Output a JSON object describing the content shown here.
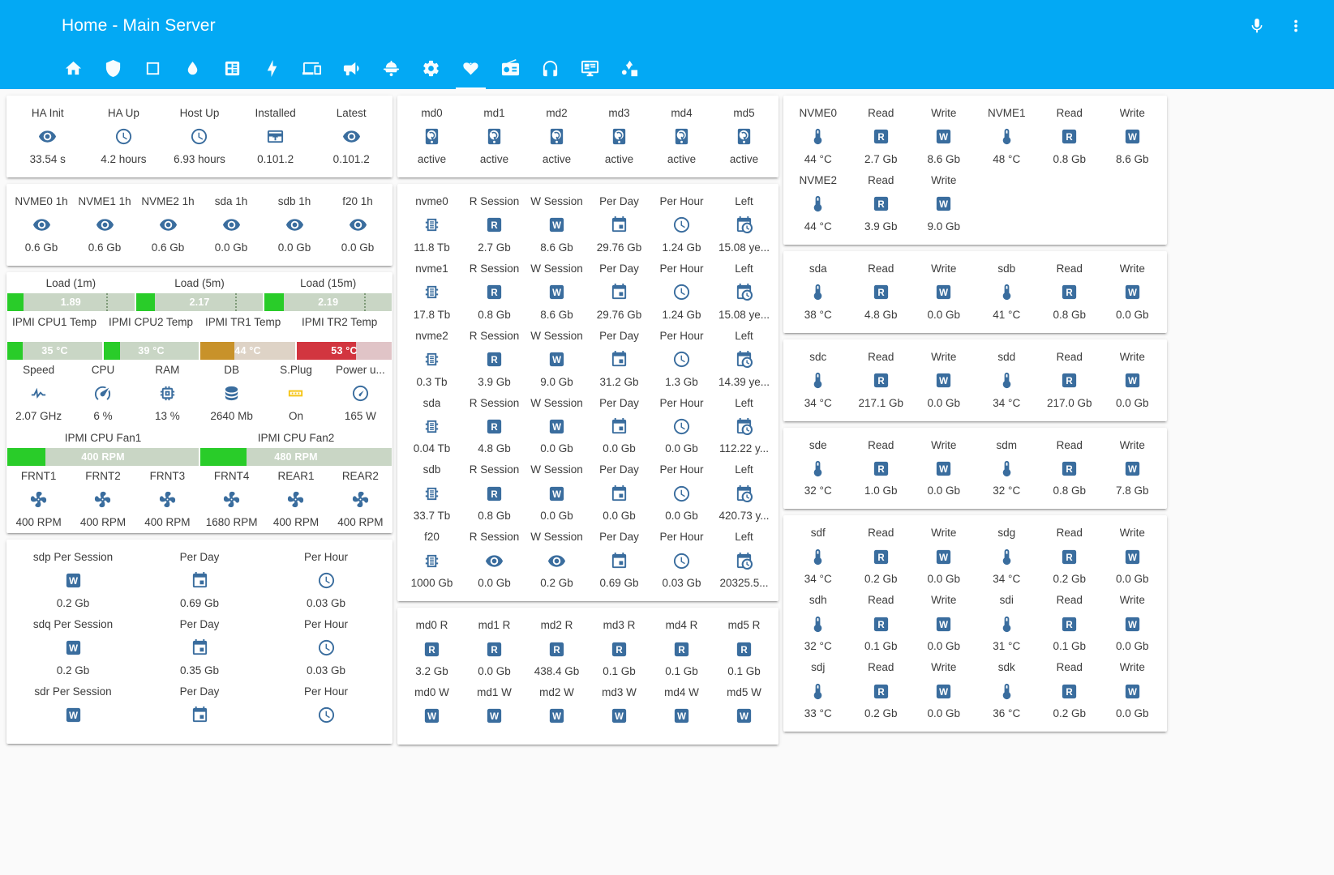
{
  "header": {
    "title": "Home - Main Server",
    "actions": [
      {
        "name": "assist-microphone-icon",
        "icon": "microphone"
      },
      {
        "name": "overflow-menu-icon",
        "icon": "dots-vertical"
      }
    ],
    "tabs": [
      {
        "name": "tab-home",
        "icon": "home",
        "active": false
      },
      {
        "name": "tab-shield",
        "icon": "shield",
        "active": false
      },
      {
        "name": "tab-square",
        "icon": "square",
        "active": false
      },
      {
        "name": "tab-water",
        "icon": "water",
        "active": false
      },
      {
        "name": "tab-calendar-grid",
        "icon": "book-grid",
        "active": false
      },
      {
        "name": "tab-lightning",
        "icon": "flash",
        "active": false
      },
      {
        "name": "tab-devices",
        "icon": "devices",
        "active": false
      },
      {
        "name": "tab-broadcast",
        "icon": "bullhorn",
        "active": false
      },
      {
        "name": "tab-lamp",
        "icon": "ceiling-light",
        "active": false
      },
      {
        "name": "tab-settings",
        "icon": "cog",
        "active": false
      },
      {
        "name": "tab-system-monitor",
        "icon": "heart-pulse",
        "active": true
      },
      {
        "name": "tab-radio",
        "icon": "radio",
        "active": false
      },
      {
        "name": "tab-headphones",
        "icon": "headphones",
        "active": false
      },
      {
        "name": "tab-monitor-dashboard",
        "icon": "monitor-dashboard",
        "active": false
      },
      {
        "name": "tab-shapes",
        "icon": "shapes",
        "active": false
      }
    ]
  },
  "cards": {
    "ha_status": {
      "columns": 5,
      "cells": [
        {
          "name": "HA Init",
          "icon": "eye",
          "value": "33.54 s"
        },
        {
          "name": "HA Up",
          "icon": "clock-filled",
          "value": "4.2 hours"
        },
        {
          "name": "Host Up",
          "icon": "clock-outline",
          "value": "6.93 hours"
        },
        {
          "name": "Installed",
          "icon": "package-up",
          "value": "0.101.2"
        },
        {
          "name": "Latest",
          "icon": "eye",
          "value": "0.101.2"
        }
      ]
    },
    "disk_1h": {
      "columns": 6,
      "cells": [
        {
          "name": "NVME0 1h",
          "icon": "eye",
          "value": "0.6 Gb"
        },
        {
          "name": "NVME1 1h",
          "icon": "eye",
          "value": "0.6 Gb"
        },
        {
          "name": "NVME2 1h",
          "icon": "eye",
          "value": "0.6 Gb"
        },
        {
          "name": "sda 1h",
          "icon": "eye",
          "value": "0.0 Gb"
        },
        {
          "name": "sdb 1h",
          "icon": "eye",
          "value": "0.0 Gb"
        },
        {
          "name": "f20 1h",
          "icon": "eye",
          "value": "0.0 Gb"
        }
      ]
    },
    "load": {
      "bars": [
        {
          "label": "Load (1m)",
          "value": "1.89",
          "fill_pct": 13,
          "sev_pct": 78,
          "state": "ok"
        },
        {
          "label": "Load (5m)",
          "value": "2.17",
          "fill_pct": 15,
          "sev_pct": 78,
          "state": "ok"
        },
        {
          "label": "Load (15m)",
          "value": "2.19",
          "fill_pct": 15,
          "sev_pct": 78,
          "state": "ok"
        }
      ]
    },
    "ipmi_temps": {
      "bars": [
        {
          "label": "IPMI CPU1 Temp",
          "value": "35 °C",
          "fill_pct": 16,
          "state": "ok"
        },
        {
          "label": "IPMI CPU2 Temp",
          "value": "39 °C",
          "fill_pct": 17,
          "state": "ok"
        },
        {
          "label": "IPMI TR1 Temp",
          "value": "44 °C",
          "fill_pct": 36,
          "state": "warn"
        },
        {
          "label": "IPMI TR2 Temp",
          "value": "53 °C",
          "fill_pct": 62,
          "state": "crit"
        }
      ]
    },
    "system": {
      "columns": 6,
      "cells": [
        {
          "name": "Speed",
          "icon": "pulse",
          "value": "2.07 GHz"
        },
        {
          "name": "CPU",
          "icon": "speedometer",
          "value": "6 %"
        },
        {
          "name": "RAM",
          "icon": "memory",
          "value": "13 %"
        },
        {
          "name": "DB",
          "icon": "database",
          "value": "2640 Mb"
        },
        {
          "name": "S.Plug",
          "icon": "power-plug",
          "value": "On"
        },
        {
          "name": "Power u...",
          "icon": "gauge",
          "value": "165 W"
        }
      ]
    },
    "cpu_fans": {
      "bars": [
        {
          "label": "IPMI CPU Fan1",
          "value": "400 RPM",
          "fill_pct": 20,
          "state": "ok"
        },
        {
          "label": "IPMI CPU Fan2",
          "value": "480 RPM",
          "fill_pct": 24,
          "state": "ok"
        }
      ]
    },
    "chassis_fans": {
      "columns": 6,
      "cells": [
        {
          "name": "FRNT1",
          "icon": "fan",
          "value": "400 RPM"
        },
        {
          "name": "FRNT2",
          "icon": "fan",
          "value": "400 RPM"
        },
        {
          "name": "FRNT3",
          "icon": "fan",
          "value": "400 RPM"
        },
        {
          "name": "FRNT4",
          "icon": "fan",
          "value": "1680 RPM"
        },
        {
          "name": "REAR1",
          "icon": "fan",
          "value": "400 RPM"
        },
        {
          "name": "REAR2",
          "icon": "fan",
          "value": "400 RPM"
        }
      ]
    },
    "sdp_sessions": {
      "columns": 3,
      "cells": [
        {
          "name": "sdp Per Session",
          "icon": "write",
          "value": "0.2 Gb"
        },
        {
          "name": "Per Day",
          "icon": "calendar",
          "value": "0.69 Gb"
        },
        {
          "name": "Per Hour",
          "icon": "clock-filled",
          "value": "0.03 Gb"
        },
        {
          "name": "sdq Per Session",
          "icon": "write",
          "value": "0.2 Gb"
        },
        {
          "name": "Per Day",
          "icon": "calendar",
          "value": "0.35 Gb"
        },
        {
          "name": "Per Hour",
          "icon": "clock-filled",
          "value": "0.03 Gb"
        },
        {
          "name": "sdr Per Session",
          "icon": "write",
          "value": ""
        },
        {
          "name": "Per Day",
          "icon": "calendar",
          "value": ""
        },
        {
          "name": "Per Hour",
          "icon": "clock-filled",
          "value": ""
        }
      ]
    },
    "md_arrays": {
      "columns": 6,
      "cells": [
        {
          "name": "md0",
          "icon": "harddisk",
          "value": "active"
        },
        {
          "name": "md1",
          "icon": "harddisk",
          "value": "active"
        },
        {
          "name": "md2",
          "icon": "harddisk",
          "value": "active"
        },
        {
          "name": "md3",
          "icon": "harddisk",
          "value": "active"
        },
        {
          "name": "md4",
          "icon": "harddisk",
          "value": "active"
        },
        {
          "name": "md5",
          "icon": "harddisk",
          "value": "active"
        }
      ]
    },
    "drive_lifetime": {
      "columns": 6,
      "cells": [
        {
          "name": "nvme0",
          "icon": "chip",
          "value": "11.8 Tb"
        },
        {
          "name": "R Session",
          "icon": "read",
          "value": "2.7 Gb"
        },
        {
          "name": "W Session",
          "icon": "write",
          "value": "8.6 Gb"
        },
        {
          "name": "Per Day",
          "icon": "calendar",
          "value": "29.76 Gb"
        },
        {
          "name": "Per Hour",
          "icon": "clock-filled",
          "value": "1.24 Gb"
        },
        {
          "name": "Left",
          "icon": "calendar-clock",
          "value": "15.08 ye..."
        },
        {
          "name": "nvme1",
          "icon": "chip",
          "value": "17.8 Tb"
        },
        {
          "name": "R Session",
          "icon": "read",
          "value": "0.8 Gb"
        },
        {
          "name": "W Session",
          "icon": "write",
          "value": "8.6 Gb"
        },
        {
          "name": "Per Day",
          "icon": "calendar",
          "value": "29.76 Gb"
        },
        {
          "name": "Per Hour",
          "icon": "clock-filled",
          "value": "1.24 Gb"
        },
        {
          "name": "Left",
          "icon": "calendar-clock",
          "value": "15.08 ye..."
        },
        {
          "name": "nvme2",
          "icon": "chip",
          "value": "0.3 Tb"
        },
        {
          "name": "R Session",
          "icon": "read",
          "value": "3.9 Gb"
        },
        {
          "name": "W Session",
          "icon": "write",
          "value": "9.0 Gb"
        },
        {
          "name": "Per Day",
          "icon": "calendar",
          "value": "31.2 Gb"
        },
        {
          "name": "Per Hour",
          "icon": "clock-filled",
          "value": "1.3 Gb"
        },
        {
          "name": "Left",
          "icon": "calendar-clock",
          "value": "14.39 ye..."
        },
        {
          "name": "sda",
          "icon": "chip",
          "value": "0.04 Tb"
        },
        {
          "name": "R Session",
          "icon": "read",
          "value": "4.8 Gb"
        },
        {
          "name": "W Session",
          "icon": "write",
          "value": "0.0 Gb"
        },
        {
          "name": "Per Day",
          "icon": "calendar",
          "value": "0.0 Gb"
        },
        {
          "name": "Per Hour",
          "icon": "clock-filled",
          "value": "0.0 Gb"
        },
        {
          "name": "Left",
          "icon": "calendar-clock",
          "value": "112.22 y..."
        },
        {
          "name": "sdb",
          "icon": "chip",
          "value": "33.7 Tb"
        },
        {
          "name": "R Session",
          "icon": "read",
          "value": "0.8 Gb"
        },
        {
          "name": "W Session",
          "icon": "write",
          "value": "0.0 Gb"
        },
        {
          "name": "Per Day",
          "icon": "calendar",
          "value": "0.0 Gb"
        },
        {
          "name": "Per Hour",
          "icon": "clock-filled",
          "value": "0.0 Gb"
        },
        {
          "name": "Left",
          "icon": "calendar-clock",
          "value": "420.73 y..."
        },
        {
          "name": "f20",
          "icon": "chip",
          "value": "1000 Gb"
        },
        {
          "name": "R Session",
          "icon": "eye",
          "value": "0.0 Gb"
        },
        {
          "name": "W Session",
          "icon": "eye",
          "value": "0.2 Gb"
        },
        {
          "name": "Per Day",
          "icon": "calendar",
          "value": "0.69 Gb"
        },
        {
          "name": "Per Hour",
          "icon": "clock-filled",
          "value": "0.03 Gb"
        },
        {
          "name": "Left",
          "icon": "calendar-clock",
          "value": "20325.5..."
        }
      ]
    },
    "md_rw": {
      "columns": 6,
      "cells": [
        {
          "name": "md0 R",
          "icon": "read",
          "value": "3.2 Gb"
        },
        {
          "name": "md1 R",
          "icon": "read",
          "value": "0.0 Gb"
        },
        {
          "name": "md2 R",
          "icon": "read",
          "value": "438.4 Gb"
        },
        {
          "name": "md3 R",
          "icon": "read",
          "value": "0.1 Gb"
        },
        {
          "name": "md4 R",
          "icon": "read",
          "value": "0.1 Gb"
        },
        {
          "name": "md5 R",
          "icon": "read",
          "value": "0.1 Gb"
        },
        {
          "name": "md0 W",
          "icon": "write",
          "value": ""
        },
        {
          "name": "md1 W",
          "icon": "write",
          "value": ""
        },
        {
          "name": "md2 W",
          "icon": "write",
          "value": ""
        },
        {
          "name": "md3 W",
          "icon": "write",
          "value": ""
        },
        {
          "name": "md4 W",
          "icon": "write",
          "value": ""
        },
        {
          "name": "md5 W",
          "icon": "write",
          "value": ""
        }
      ]
    },
    "nvme_temps": {
      "columns": 6,
      "cells": [
        {
          "name": "NVME0",
          "icon": "thermometer",
          "value": "44 °C"
        },
        {
          "name": "Read",
          "icon": "read",
          "value": "2.7 Gb"
        },
        {
          "name": "Write",
          "icon": "write",
          "value": "8.6 Gb"
        },
        {
          "name": "NVME1",
          "icon": "thermometer",
          "value": "48 °C"
        },
        {
          "name": "Read",
          "icon": "read",
          "value": "0.8 Gb"
        },
        {
          "name": "Write",
          "icon": "write",
          "value": "8.6 Gb"
        },
        {
          "name": "NVME2",
          "icon": "thermometer",
          "value": "44 °C"
        },
        {
          "name": "Read",
          "icon": "read",
          "value": "3.9 Gb"
        },
        {
          "name": "Write",
          "icon": "write",
          "value": "9.0 Gb"
        },
        {
          "name": "",
          "icon": "",
          "value": ""
        },
        {
          "name": "",
          "icon": "",
          "value": ""
        },
        {
          "name": "",
          "icon": "",
          "value": ""
        }
      ]
    },
    "disk_ab": {
      "columns": 6,
      "cells": [
        {
          "name": "sda",
          "icon": "thermometer",
          "value": "38 °C"
        },
        {
          "name": "Read",
          "icon": "read",
          "value": "4.8 Gb"
        },
        {
          "name": "Write",
          "icon": "write",
          "value": "0.0 Gb"
        },
        {
          "name": "sdb",
          "icon": "thermometer",
          "value": "41 °C"
        },
        {
          "name": "Read",
          "icon": "read",
          "value": "0.8 Gb"
        },
        {
          "name": "Write",
          "icon": "write",
          "value": "0.0 Gb"
        }
      ]
    },
    "disk_cd": {
      "columns": 6,
      "cells": [
        {
          "name": "sdc",
          "icon": "thermometer",
          "value": "34 °C"
        },
        {
          "name": "Read",
          "icon": "read",
          "value": "217.1 Gb"
        },
        {
          "name": "Write",
          "icon": "write",
          "value": "0.0 Gb"
        },
        {
          "name": "sdd",
          "icon": "thermometer",
          "value": "34 °C"
        },
        {
          "name": "Read",
          "icon": "read",
          "value": "217.0 Gb"
        },
        {
          "name": "Write",
          "icon": "write",
          "value": "0.0 Gb"
        }
      ]
    },
    "disk_em": {
      "columns": 6,
      "cells": [
        {
          "name": "sde",
          "icon": "thermometer",
          "value": "32 °C"
        },
        {
          "name": "Read",
          "icon": "read",
          "value": "1.0 Gb"
        },
        {
          "name": "Write",
          "icon": "write",
          "value": "0.0 Gb"
        },
        {
          "name": "sdm",
          "icon": "thermometer",
          "value": "32 °C"
        },
        {
          "name": "Read",
          "icon": "read",
          "value": "0.8 Gb"
        },
        {
          "name": "Write",
          "icon": "write",
          "value": "7.8 Gb"
        }
      ]
    },
    "disk_fk": {
      "columns": 6,
      "cells": [
        {
          "name": "sdf",
          "icon": "thermometer",
          "value": "34 °C"
        },
        {
          "name": "Read",
          "icon": "read",
          "value": "0.2 Gb"
        },
        {
          "name": "Write",
          "icon": "write",
          "value": "0.0 Gb"
        },
        {
          "name": "sdg",
          "icon": "thermometer",
          "value": "34 °C"
        },
        {
          "name": "Read",
          "icon": "read",
          "value": "0.2 Gb"
        },
        {
          "name": "Write",
          "icon": "write",
          "value": "0.0 Gb"
        },
        {
          "name": "sdh",
          "icon": "thermometer",
          "value": "32 °C"
        },
        {
          "name": "Read",
          "icon": "read",
          "value": "0.1 Gb"
        },
        {
          "name": "Write",
          "icon": "write",
          "value": "0.0 Gb"
        },
        {
          "name": "sdi",
          "icon": "thermometer",
          "value": "31 °C"
        },
        {
          "name": "Read",
          "icon": "read",
          "value": "0.1 Gb"
        },
        {
          "name": "Write",
          "icon": "write",
          "value": "0.0 Gb"
        },
        {
          "name": "sdj",
          "icon": "thermometer",
          "value": "33 °C"
        },
        {
          "name": "Read",
          "icon": "read",
          "value": "0.2 Gb"
        },
        {
          "name": "Write",
          "icon": "write",
          "value": "0.0 Gb"
        },
        {
          "name": "sdk",
          "icon": "thermometer",
          "value": "36 °C"
        },
        {
          "name": "Read",
          "icon": "read",
          "value": "0.2 Gb"
        },
        {
          "name": "Write",
          "icon": "write",
          "value": "0.0 Gb"
        }
      ]
    }
  }
}
